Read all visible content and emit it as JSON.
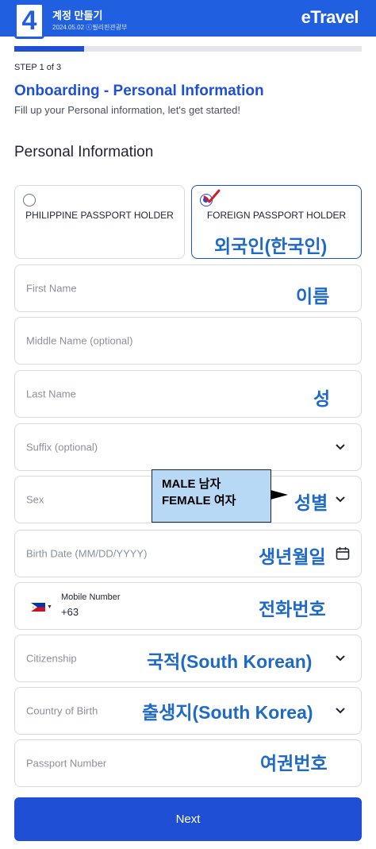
{
  "header": {
    "step_badge": "4",
    "title": "계정 만들기",
    "subtitle": "2024.05.02 ⓒ필리핀관광부",
    "brand": "eTravel",
    "bg_color": "#1f5fe0"
  },
  "progress": {
    "fraction": 0.2
  },
  "step_label": "STEP 1 of 3",
  "page_title": "Onboarding - Personal Information",
  "page_subtitle": "Fill up your Personal information, let's get started!",
  "section_title": "Personal Information",
  "passport_options": [
    {
      "label": "PHILIPPINE PASSPORT HOLDER",
      "selected": false
    },
    {
      "label": "FOREIGN PASSPORT HOLDER",
      "selected": true,
      "annotation": "외국인(한국인)"
    }
  ],
  "fields": {
    "first_name": {
      "placeholder": "First Name",
      "annotation": "이름"
    },
    "middle_name": {
      "placeholder": "Middle Name (optional)"
    },
    "last_name": {
      "placeholder": "Last Name",
      "annotation": "성"
    },
    "suffix": {
      "placeholder": "Suffix (optional)",
      "icon": "chevron-down-icon"
    },
    "sex": {
      "placeholder": "Sex",
      "annotation": "성별",
      "icon": "chevron-down-icon"
    },
    "birth_date": {
      "placeholder": "Birth Date (MM/DD/YYYY)",
      "annotation": "생년월일",
      "icon": "calendar-icon"
    },
    "mobile": {
      "caption": "Mobile Number",
      "value": "+63",
      "annotation": "전화번호",
      "flag": "philippines-flag-icon"
    },
    "citizenship": {
      "placeholder": "Citizenship",
      "annotation": "국적(South Korean)",
      "icon": "chevron-down-icon"
    },
    "country_of_birth": {
      "placeholder": "Country of Birth",
      "annotation": "출생지(South Korea)",
      "icon": "chevron-down-icon"
    },
    "passport_number": {
      "placeholder": "Passport Number",
      "annotation": "여권번호"
    }
  },
  "callout": {
    "line1": "MALE 남자",
    "line2": "FEMALE 여자"
  },
  "next_button": "Next",
  "colors": {
    "primary": "#1f4fd4",
    "annotation": "#1f69c8",
    "check": "#d11f2a"
  }
}
